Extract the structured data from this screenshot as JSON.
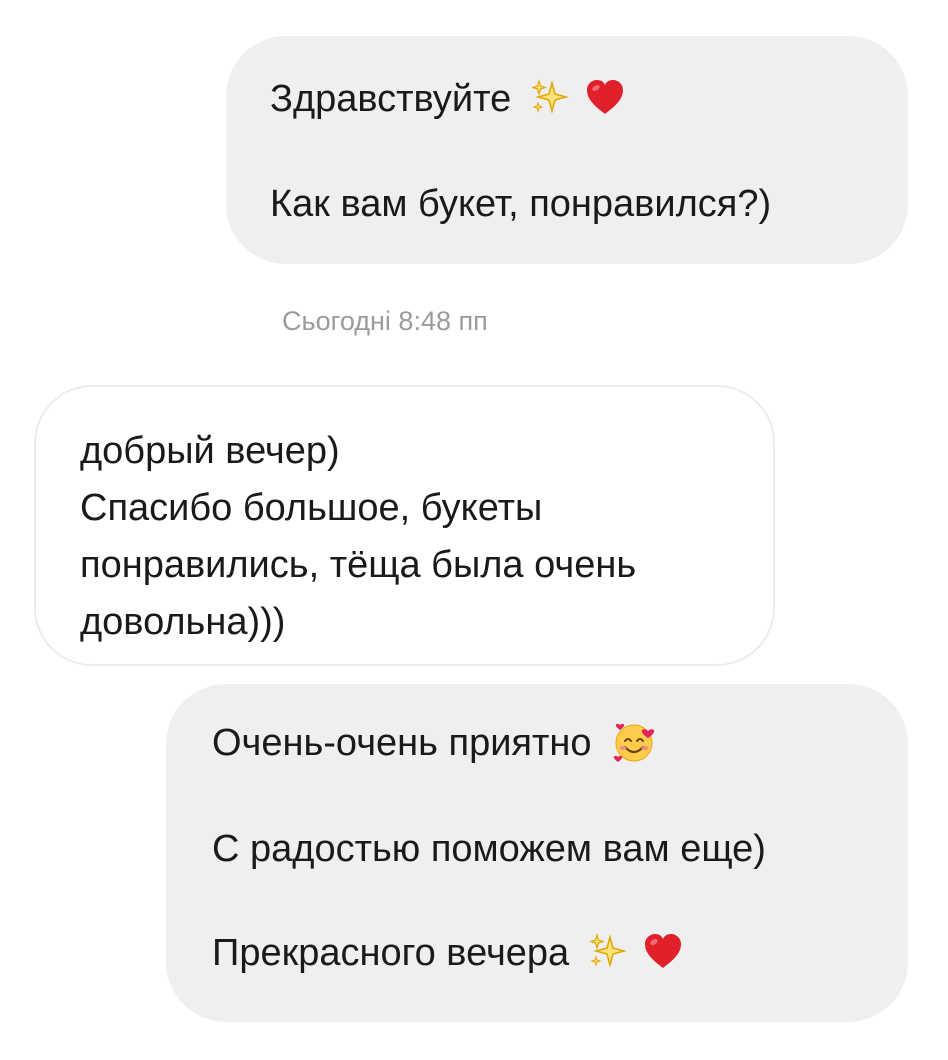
{
  "messages": [
    {
      "direction": "outgoing",
      "lines": [
        "Здравствуйте",
        "Как вам букет, понравился?)"
      ],
      "emoji": [
        "sparkles-icon",
        "red-heart-icon"
      ]
    },
    {
      "direction": "incoming",
      "lines": [
        "добрый вечер)",
        "Спасибо большое, букеты",
        "понравились, тёща была очень",
        "довольна)))"
      ]
    },
    {
      "direction": "outgoing",
      "lines": [
        "Очень-очень приятно",
        "С радостью поможем вам еще)",
        "Прекрасного вечера"
      ],
      "emoji": [
        "smiling-face-with-hearts-icon",
        "sparkles-icon",
        "red-heart-icon"
      ]
    }
  ],
  "timestamp": "Сьогодні 8:48 пп",
  "colors": {
    "outgoing_bubble": "#efefef",
    "incoming_bubble": "#ffffff",
    "incoming_border": "#ececec",
    "text": "#1a1a1a",
    "timestamp_text": "#9b9b9b",
    "sparkle": "#f4c430",
    "heart": "#e0212b"
  }
}
